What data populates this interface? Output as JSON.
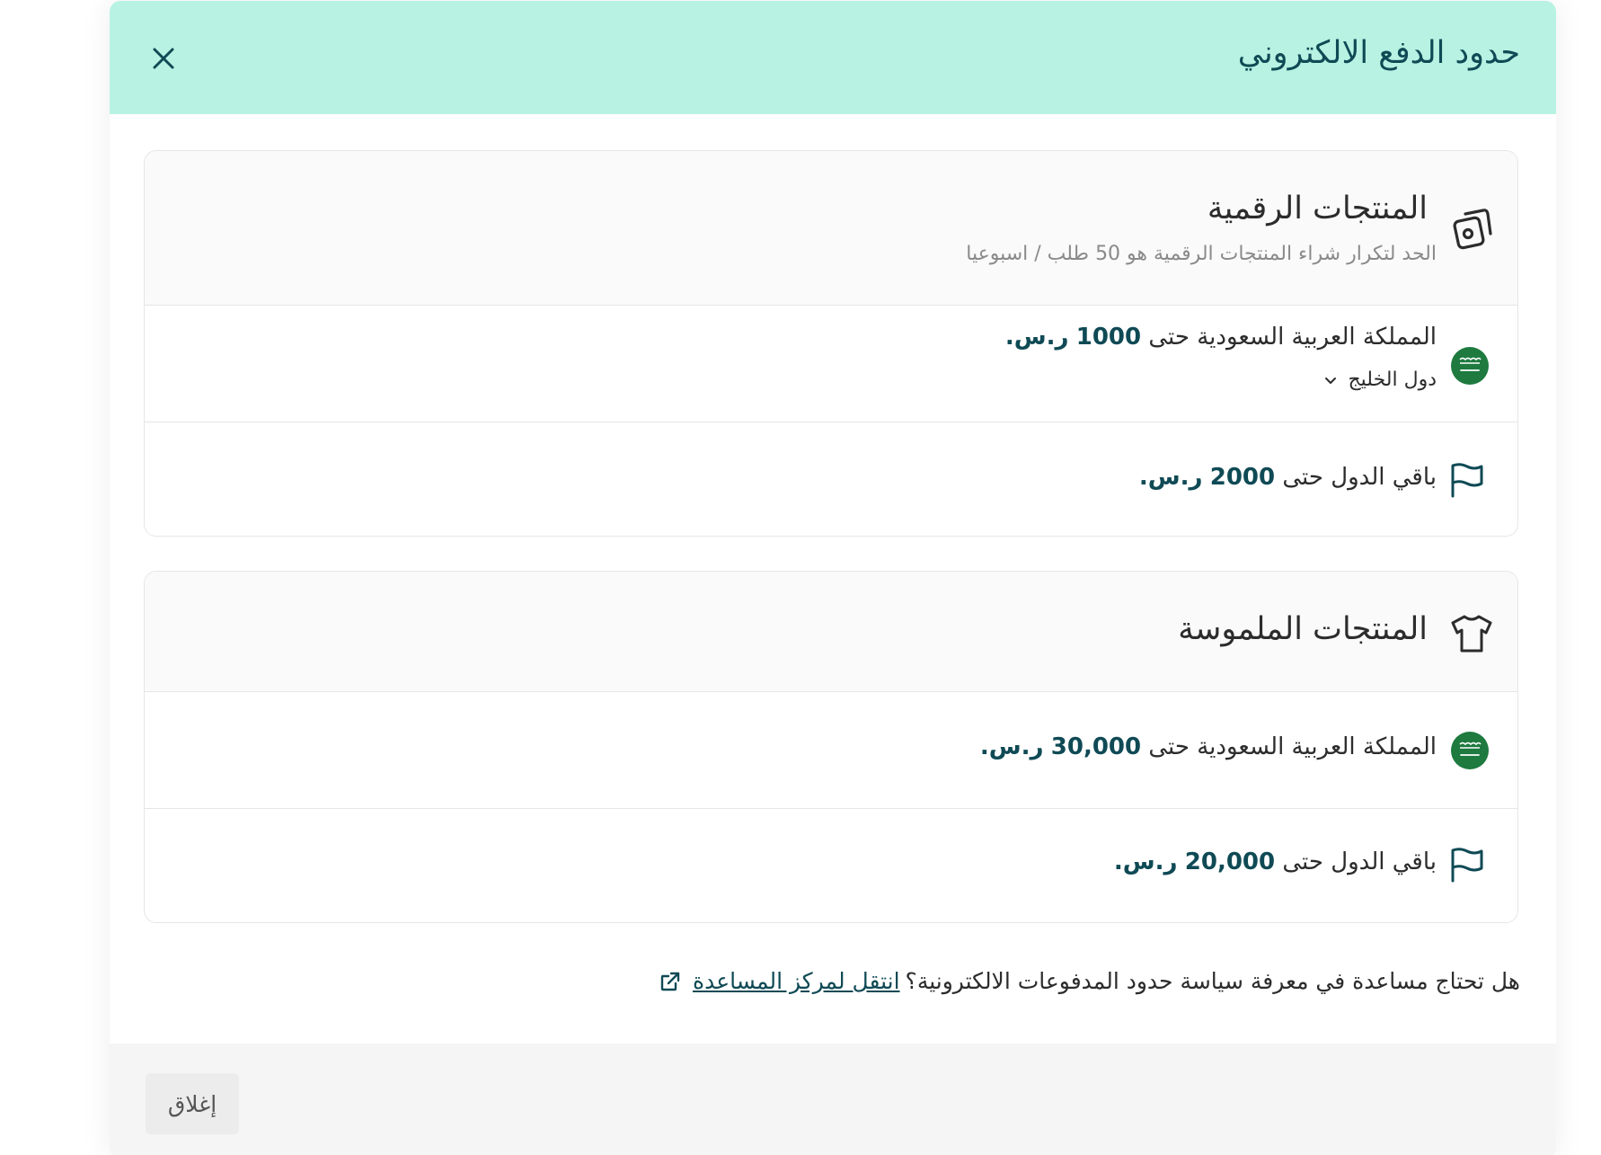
{
  "modal": {
    "title": "حدود الدفع الالكتروني",
    "close_icon": "close-icon"
  },
  "digital": {
    "title": "المنتجات الرقمية",
    "subtitle": "الحد لتكرار شراء المنتجات الرقمية هو 50 طلب / اسبوعيا",
    "icon": "digital-product-icon",
    "saudi": {
      "prefix": "المملكة العربية السعودية حتى",
      "amount": "1000",
      "currency": "ر.س."
    },
    "region_toggle": "دول الخليج",
    "others": {
      "prefix": "باقي الدول حتى",
      "amount": "2000",
      "currency": "ر.س."
    }
  },
  "physical": {
    "title": "المنتجات الملموسة",
    "icon": "tshirt-icon",
    "saudi": {
      "prefix": "المملكة العربية السعودية حتى",
      "amount": "30,000",
      "currency": "ر.س."
    },
    "others": {
      "prefix": "باقي الدول حتى",
      "amount": "20,000",
      "currency": "ر.س."
    }
  },
  "help": {
    "question": "هل تحتاج مساعدة في معرفة سياسة حدود المدفوعات الالكترونية؟",
    "link": "انتقل لمركز المساعدة"
  },
  "footer": {
    "close_label": "إغلاق"
  },
  "colors": {
    "header_bg": "#b7f2e3",
    "brand": "#0f4a55",
    "saudi_green": "#1e7a3f"
  }
}
